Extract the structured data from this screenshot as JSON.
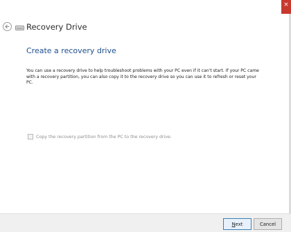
{
  "window": {
    "title": "Recovery Drive",
    "close_glyph": "×"
  },
  "page": {
    "heading": "Create a recovery drive",
    "description": "You can use a recovery drive to help troubleshoot problems with your PC even if it can't start. If your PC came with a recovery partition, you can also copy it to the recovery drive so you can use it to refresh or reset your PC."
  },
  "option": {
    "checkbox_label": "Copy the recovery partition from the PC to the recovery drive.",
    "checked": false,
    "enabled": false
  },
  "buttons": {
    "next_accel": "N",
    "next_rest": "ext",
    "cancel": "Cancel"
  },
  "icons": {
    "back": "back-arrow-icon",
    "drive": "drive-icon",
    "close": "close-icon"
  },
  "colors": {
    "heading": "#1e4e8c",
    "close_button": "#c7392f",
    "next_border": "#3c7fb1"
  }
}
